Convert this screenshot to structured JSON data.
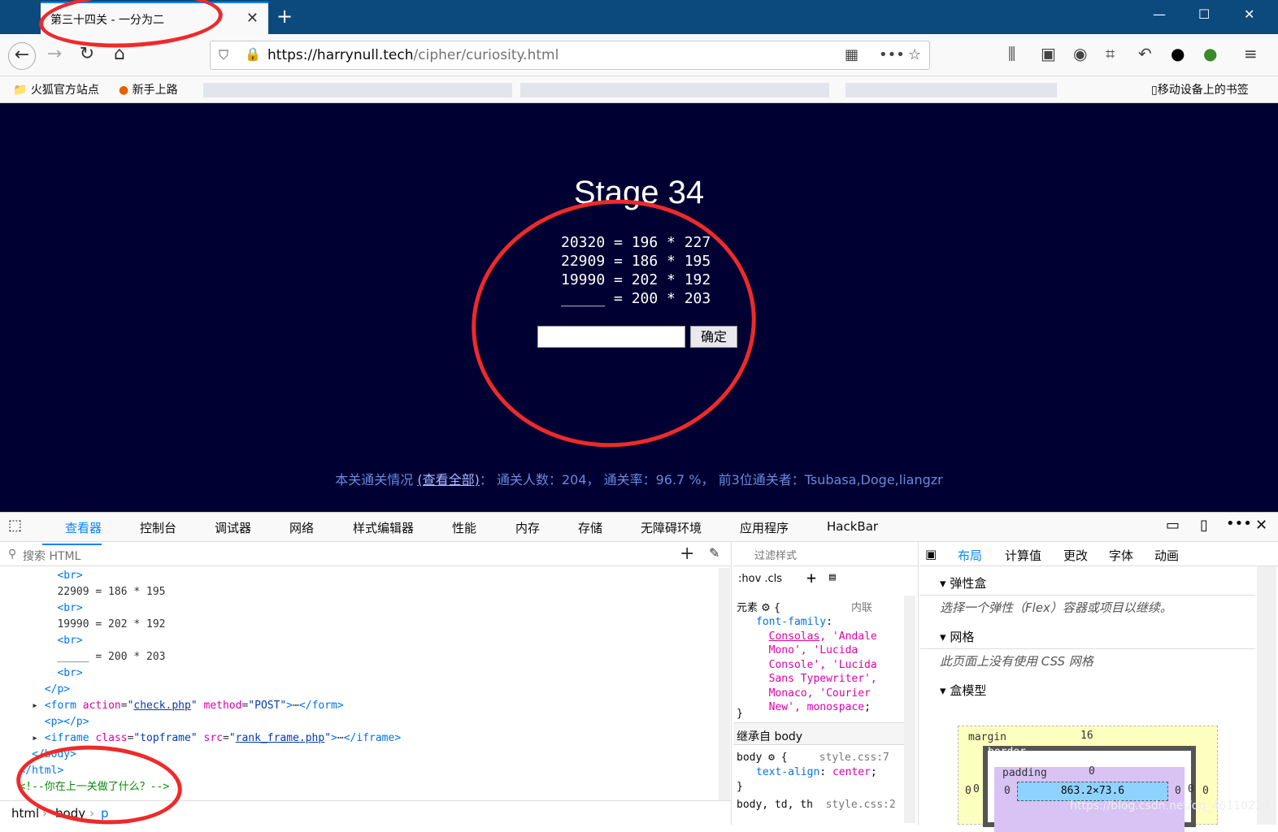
{
  "browser": {
    "tab_title": "第三十四关 - 一分为二",
    "url_domain": "https://harrynull.tech",
    "url_path": "/cipher/curiosity.html",
    "bookmarks": [
      "火狐官方站点",
      "新手上路"
    ],
    "mobile_bookmarks": "移动设备上的书签"
  },
  "page": {
    "stage_title": "Stage 34",
    "lines": [
      "20320 = 196 * 227",
      "22909 = 186 * 195",
      "19990 = 202 * 192",
      "_____ = 200 * 203"
    ],
    "submit_label": "确定",
    "stats": {
      "prefix": "本关通关情况",
      "view_all": "(查看全部)",
      "rest": "：  通关人数：204，  通关率：96.7 %，  前3位通关者：Tsubasa,Doge,liangzr"
    }
  },
  "devtools": {
    "tabs": [
      "查看器",
      "控制台",
      "调试器",
      "网络",
      "样式编辑器",
      "性能",
      "内存",
      "存储",
      "无障碍环境",
      "应用程序",
      "HackBar"
    ],
    "search_placeholder": "搜索 HTML",
    "breadcrumbs": [
      "html",
      "body",
      "p"
    ],
    "rules_filter": "过滤样式",
    "rules_hov": ":hov .cls",
    "layout_tabs": [
      "布局",
      "计算值",
      "更改",
      "字体",
      "动画"
    ],
    "flex_title": "弹性盒",
    "flex_note": "选择一个弹性（Flex）容器或项目以继续。",
    "grid_title": "网格",
    "grid_note": "此页面上没有使用 CSS 网格",
    "box_title": "盒模型",
    "box": {
      "margin_label": "margin",
      "margin_top": "16",
      "border_label": "border",
      "padding_label": "padding",
      "content": "863.2×73.6",
      "zero": "0"
    },
    "comment": "<!--你在上一关做了什么？-->",
    "watermark": "https://blog.csdn.net/qq_46110224"
  }
}
